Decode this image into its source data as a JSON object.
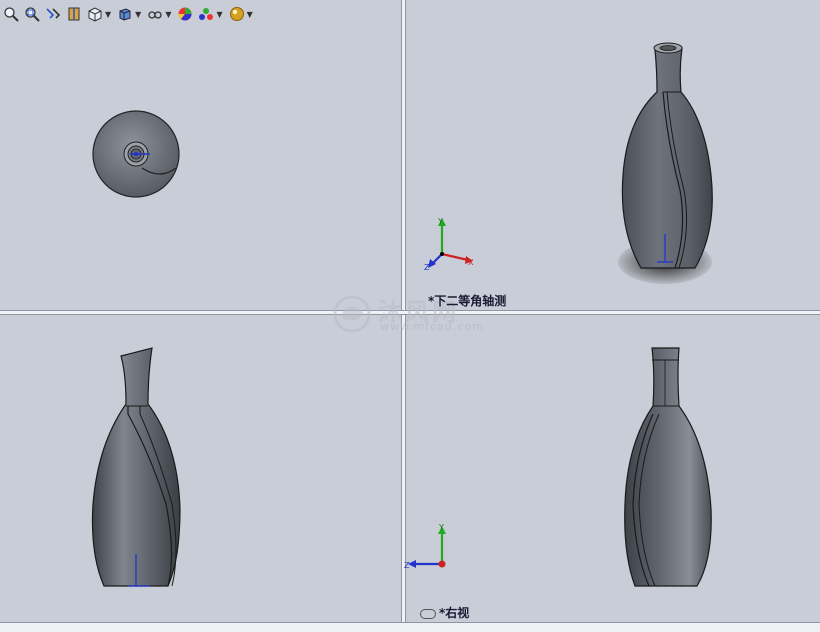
{
  "toolbar": {
    "buttons": [
      {
        "icon": "zoom-to-fit-icon"
      },
      {
        "icon": "zoom-to-area-icon"
      },
      {
        "icon": "previous-view-icon"
      },
      {
        "icon": "section-view-icon"
      },
      {
        "icon": "view-orientation-icon",
        "dropdown": true
      },
      {
        "icon": "display-style-icon",
        "dropdown": true
      },
      {
        "icon": "hide-show-items-icon",
        "dropdown": true
      },
      {
        "icon": "edit-appearance-icon"
      },
      {
        "icon": "apply-scene-icon",
        "dropdown": true
      },
      {
        "icon": "view-settings-icon",
        "dropdown": true
      }
    ]
  },
  "viewports": {
    "bottom_right_label": "*右视",
    "top_right_label": "*下二等角轴测"
  },
  "triad": {
    "x": "X",
    "y": "Y",
    "z": "Z"
  },
  "watermark": {
    "text": "沐风网",
    "url": "www.mfcad.com"
  },
  "colors": {
    "background": "#c9cdd7",
    "model": "#5a5f69",
    "axis_x": "#cc2222",
    "axis_y": "#22aa22",
    "axis_z": "#2233cc"
  }
}
